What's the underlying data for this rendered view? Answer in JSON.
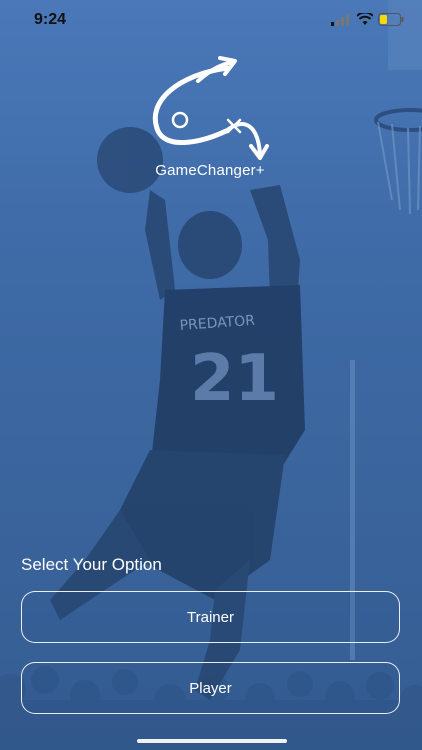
{
  "status_bar": {
    "time": "9:24"
  },
  "logo": {
    "name": "GameChanger+"
  },
  "options": {
    "title": "Select Your Option",
    "buttons": [
      {
        "label": "Trainer"
      },
      {
        "label": "Player"
      }
    ]
  },
  "background_photo": {
    "jersey_text": "PREDATOR",
    "jersey_number": "21"
  },
  "colors": {
    "overlay": "#3e6aa6",
    "text": "#ffffff",
    "battery_fill": "#f5d90a"
  }
}
